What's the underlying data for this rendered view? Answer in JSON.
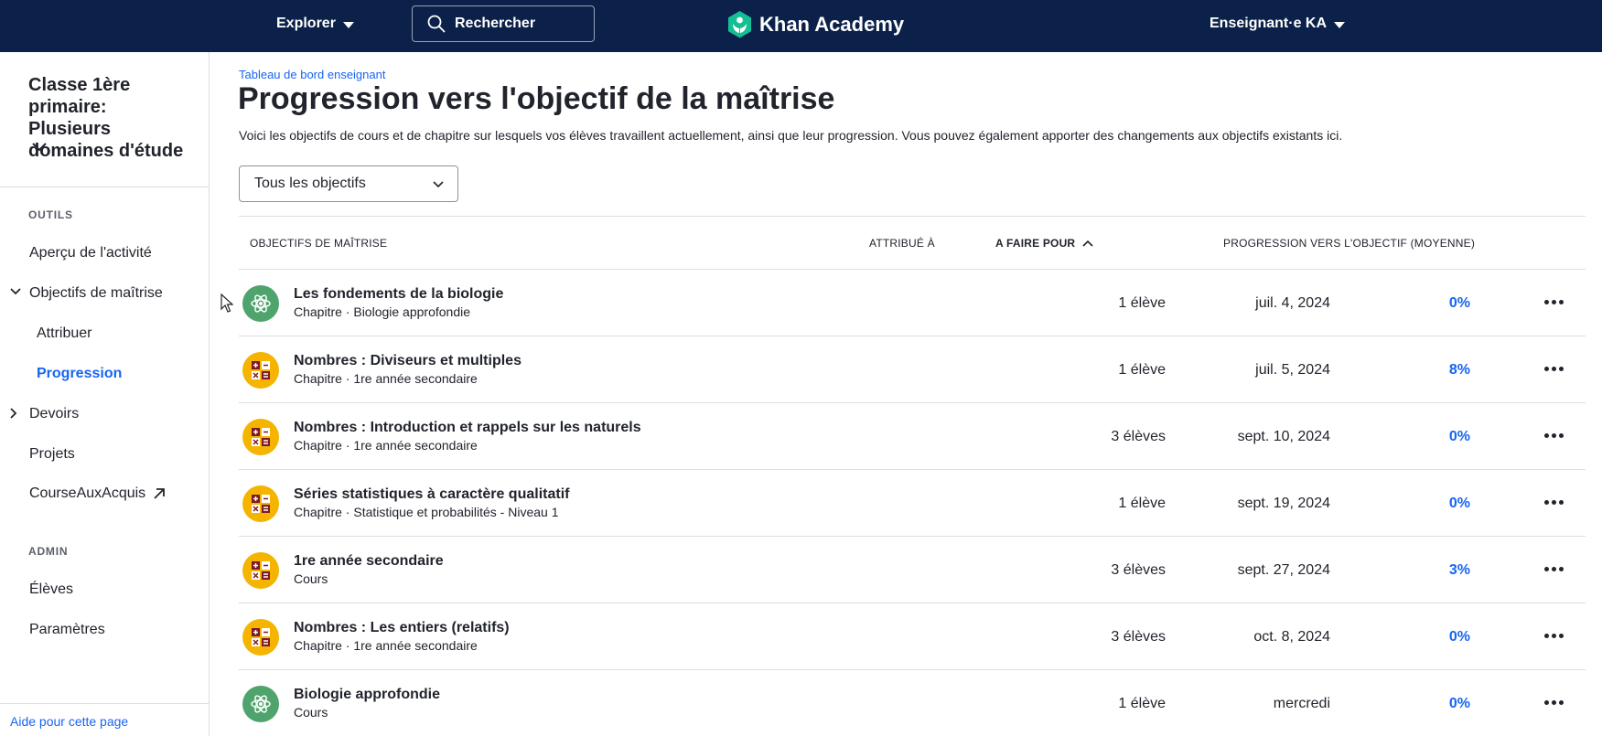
{
  "header": {
    "explore_label": "Explorer",
    "search_label": "Rechercher",
    "brand": "Khan Academy",
    "user_label": "Enseignant·e KA"
  },
  "sidebar": {
    "class_title": "Classe 1ère primaire: Plusieurs domaines d'étude",
    "tools_label": "OUTILS",
    "items": {
      "activity": "Aperçu de l'activité",
      "mastery": "Objectifs de maîtrise",
      "assign": "Attribuer",
      "progress": "Progression",
      "homework": "Devoirs",
      "projects": "Projets",
      "course_challenge": "CourseAuxAcquis"
    },
    "admin_label": "ADMIN",
    "admin_items": {
      "students": "Élèves",
      "settings": "Paramètres"
    },
    "help_link": "Aide pour cette page"
  },
  "main": {
    "breadcrumb": "Tableau de bord enseignant",
    "title": "Progression vers l'objectif de la maîtrise",
    "description": "Voici les objectifs de cours et de chapitre sur lesquels vos élèves travaillent actuellement, ainsi que leur progression. Vous pouvez également apporter des changements aux objectifs existants ici.",
    "filter_value": "Tous les objectifs",
    "columns": {
      "goal": "OBJECTIFS DE MAÎTRISE",
      "assigned": "ATTRIBUÉ À",
      "due": "A FAIRE POUR",
      "progress": "PROGRESSION VERS L'OBJECTIF (MOYENNE)"
    },
    "rows": [
      {
        "icon": "atom-icon",
        "name": "Les fondements de la biologie",
        "sub": "Chapitre · Biologie approfondie",
        "assigned": "1 élève",
        "due": "juil. 4, 2024",
        "progress": "0%"
      },
      {
        "icon": "math-symbols-icon",
        "name": "Nombres : Diviseurs et multiples",
        "sub": "Chapitre · 1re année secondaire",
        "assigned": "1 élève",
        "due": "juil. 5, 2024",
        "progress": "8%"
      },
      {
        "icon": "math-symbols-icon",
        "name": "Nombres : Introduction et rappels sur les naturels",
        "sub": "Chapitre · 1re année secondaire",
        "assigned": "3 élèves",
        "due": "sept. 10, 2024",
        "progress": "0%"
      },
      {
        "icon": "math-symbols-icon",
        "name": "Séries statistiques à caractère qualitatif",
        "sub": "Chapitre · Statistique et probabilités - Niveau 1",
        "assigned": "1 élève",
        "due": "sept. 19, 2024",
        "progress": "0%"
      },
      {
        "icon": "math-symbols-icon",
        "name": "1re année secondaire",
        "sub": "Cours",
        "assigned": "3 élèves",
        "due": "sept. 27, 2024",
        "progress": "3%"
      },
      {
        "icon": "math-symbols-icon",
        "name": "Nombres : Les entiers (relatifs)",
        "sub": "Chapitre · 1re année secondaire",
        "assigned": "3 élèves",
        "due": "oct. 8, 2024",
        "progress": "0%"
      },
      {
        "icon": "atom-icon",
        "name": "Biologie approfondie",
        "sub": "Cours",
        "assigned": "1 élève",
        "due": "mercredi",
        "progress": "0%"
      }
    ]
  }
}
